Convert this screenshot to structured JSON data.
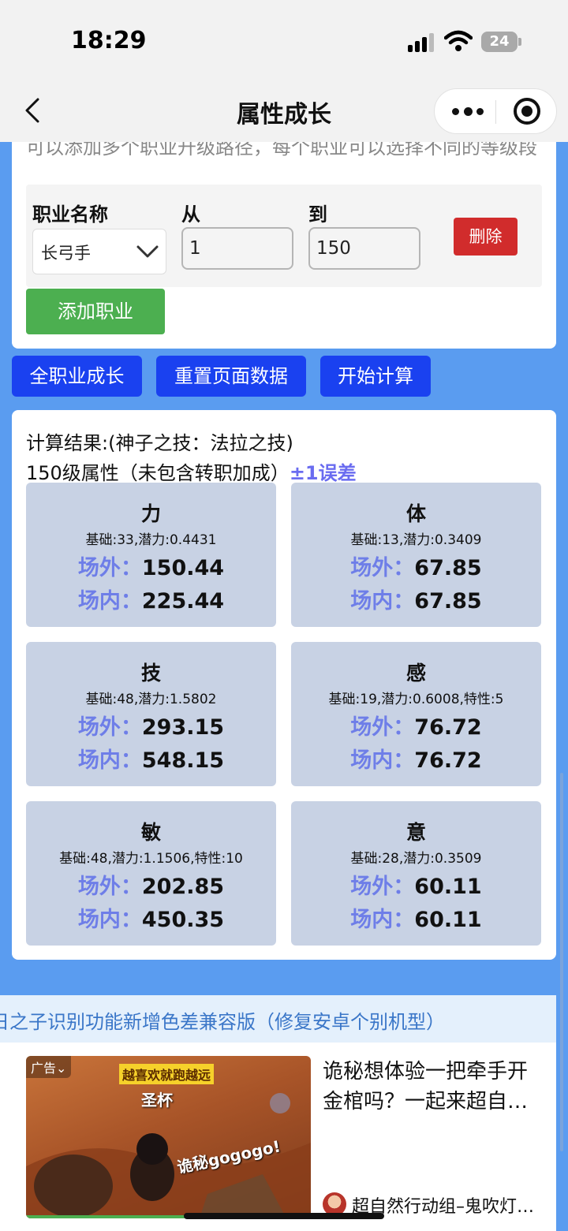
{
  "status": {
    "time": "18:29",
    "battery": "24"
  },
  "nav": {
    "title": "属性成长"
  },
  "job_section": {
    "description": "可以添加多个职业升级路径，每个职业可以选择不同的等级段",
    "labels": {
      "job": "职业名称",
      "from": "从",
      "to": "到"
    },
    "row": {
      "job": "长弓手",
      "from": "1",
      "to": "150",
      "delete": "删除"
    },
    "add_button": "添加职业"
  },
  "actions": {
    "all_growth": "全职业成长",
    "reset": "重置页面数据",
    "calculate": "开始计算"
  },
  "results": {
    "title": "计算结果:(神子之技：法拉之技)",
    "subtitle": "150级属性（未包含转职加成）",
    "error_note": "±1误差",
    "outside_label": "场外：",
    "inside_label": "场内：",
    "stats": [
      {
        "name": "力",
        "base": "基础:33,潜力:0.4431",
        "outside": "150.44",
        "inside": "225.44"
      },
      {
        "name": "体",
        "base": "基础:13,潜力:0.3409",
        "outside": "67.85",
        "inside": "67.85"
      },
      {
        "name": "技",
        "base": "基础:48,潜力:1.5802",
        "outside": "293.15",
        "inside": "548.15"
      },
      {
        "name": "感",
        "base": "基础:19,潜力:0.6008,特性:5",
        "outside": "76.72",
        "inside": "76.72"
      },
      {
        "name": "敏",
        "base": "基础:48,潜力:1.1506,特性:10",
        "outside": "202.85",
        "inside": "450.35"
      },
      {
        "name": "意",
        "base": "基础:28,潜力:0.3509",
        "outside": "60.11",
        "inside": "60.11"
      }
    ]
  },
  "notice": {
    "text": "日之子识别功能新增色差兼容版（修复安卓个别机型）"
  },
  "ad": {
    "tag": "广告⌄",
    "slogan": "越喜欢就跑越远",
    "grail": "圣杯",
    "go": "诡秘gogogo!",
    "headline": "诡秘想体验一把牵手开金棺吗？一起来超自…",
    "author": "超自然行动组–鬼吹灯…"
  },
  "colors": {
    "accent_blue": "#1a41f0",
    "add_green": "#4caf50",
    "delete_red": "#d12c2c",
    "stat_bg": "#c8d2e4",
    "page_bg": "#5a9cf0"
  }
}
